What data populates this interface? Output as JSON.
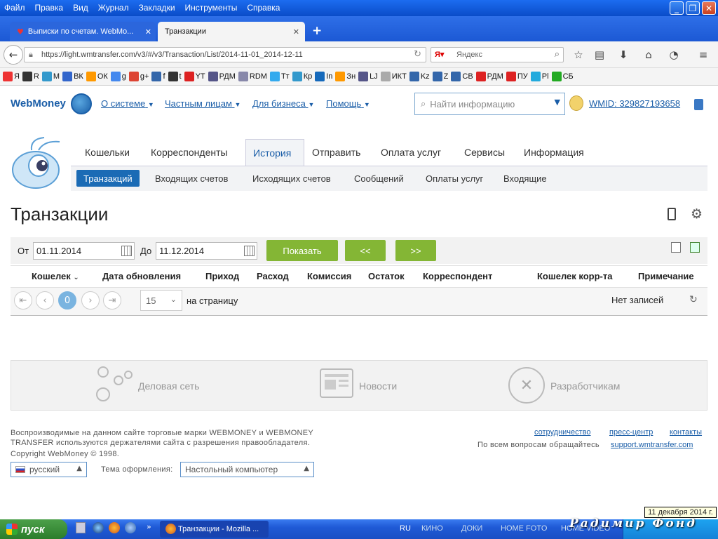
{
  "menu": [
    "Файл",
    "Правка",
    "Вид",
    "Журнал",
    "Закладки",
    "Инструменты",
    "Справка"
  ],
  "tabs": [
    {
      "label": "Выписки по счетам. WebMo..."
    },
    {
      "label": "Транзакции"
    }
  ],
  "url": "https://light.wmtransfer.com/v3/#/v3/Transaction/List/2014-11-01_2014-12-11",
  "browser_search_placeholder": "Яндекс",
  "bookmarks": [
    "Я",
    "R",
    "М",
    "ВК",
    "ОК",
    "g",
    "g+",
    "f",
    "t",
    "YT",
    "РДМ",
    "RDM",
    "Тт",
    "Кр",
    "In",
    "Зн",
    "LJ",
    "ИКТ",
    "Kz",
    "Z",
    "СВ",
    "РДМ",
    "ПУ",
    "Pl",
    "СБ"
  ],
  "site": {
    "logo": "WebMoney",
    "topnav": [
      "О системе",
      "Частным лицам",
      "Для бизнеса",
      "Помощь"
    ],
    "search_placeholder": "Найти информацию",
    "wmid": "WMID: 329827193658",
    "mainnav": [
      "Кошельки",
      "Корреспонденты",
      "История",
      "Отправить",
      "Оплата услуг",
      "Сервисы",
      "Информация"
    ],
    "subnav": [
      "Транзакций",
      "Входящих счетов",
      "Исходящих счетов",
      "Сообщений",
      "Оплаты услуг",
      "Входящие"
    ],
    "page_title": "Транзакции"
  },
  "filter": {
    "from_label": "От",
    "from_value": "01.11.2014",
    "to_label": "До",
    "to_value": "11.12.2014",
    "show_button": "Показать",
    "prev_button": "<<",
    "next_button": ">>"
  },
  "table": {
    "columns": [
      "Кошелек",
      "Дата обновления",
      "Приход",
      "Расход",
      "Комиссия",
      "Остаток",
      "Корреспондент",
      "Кошелек корр-та",
      "Примечание"
    ],
    "empty_text": "Нет записей"
  },
  "pager": {
    "current_page": "0",
    "page_size": "15",
    "per_page_label": "на страницу"
  },
  "links_panel": [
    "Деловая сеть",
    "Новости",
    "Разработчикам"
  ],
  "footer": {
    "trademark": "Воспроизводимые на данном сайте торговые марки WEBMONEY и WEBMONEY TRANSFER используются держателями сайта с разрешения правообладателя.",
    "copyright": "Copyright WebMoney © 1998.",
    "links": [
      "сотрудничество",
      "пресс-центр",
      "контакты"
    ],
    "questions": "По всем вопросам обращайтесь",
    "support": "support.wmtransfer.com",
    "language": "русский",
    "theme_label": "Тема оформления:",
    "theme_value": "Настольный компьютер"
  },
  "taskbar": {
    "start": "пуск",
    "window": "Транзакции - Mozilla ...",
    "quick": [
      "RU",
      "КИНО",
      "ДОКИ",
      "HOME FOTO",
      "HOME VIDEO"
    ],
    "watermark": "Радимир Фонд",
    "clock_tip": "11 декабря 2014 г."
  },
  "colors": {
    "accent": "#1b5ea8",
    "green_button": "#84b635",
    "active_tab": "#1b6bb5"
  }
}
